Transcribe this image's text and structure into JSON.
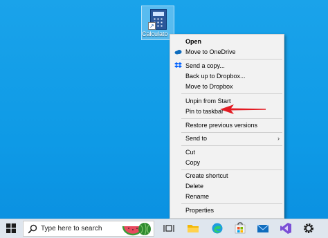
{
  "desktop": {
    "icon_label": "Calculato",
    "icon_name": "calculator-icon"
  },
  "context_menu": {
    "items": [
      {
        "label": "Open",
        "bold": true
      },
      {
        "label": "Move to OneDrive",
        "icon": "onedrive-icon"
      },
      {
        "label": "Send a copy...",
        "icon": "dropbox-icon"
      },
      {
        "label": "Back up to Dropbox..."
      },
      {
        "label": "Move to Dropbox"
      },
      {
        "label": "Unpin from Start"
      },
      {
        "label": "Pin to taskbar"
      },
      {
        "label": "Restore previous versions"
      },
      {
        "label": "Send to",
        "submenu": true
      },
      {
        "label": "Cut"
      },
      {
        "label": "Copy"
      },
      {
        "label": "Create shortcut"
      },
      {
        "label": "Delete"
      },
      {
        "label": "Rename"
      },
      {
        "label": "Properties"
      }
    ],
    "submenu_arrow": "›"
  },
  "annotation": {
    "color": "#e31b23",
    "icon": "red-arrow-pointer"
  },
  "taskbar": {
    "search_placeholder": "Type here to search",
    "icons": [
      "windows-start-icon",
      "search-icon",
      "watermelon-icon",
      "task-view-icon",
      "file-explorer-icon",
      "edge-icon",
      "store-icon",
      "mail-icon",
      "visual-studio-icon",
      "settings-gear-icon"
    ]
  },
  "colors": {
    "desktop": "#1aa3ea",
    "menu_bg": "#f2f2f2",
    "taskbar_bg": "#dfe6ee"
  }
}
